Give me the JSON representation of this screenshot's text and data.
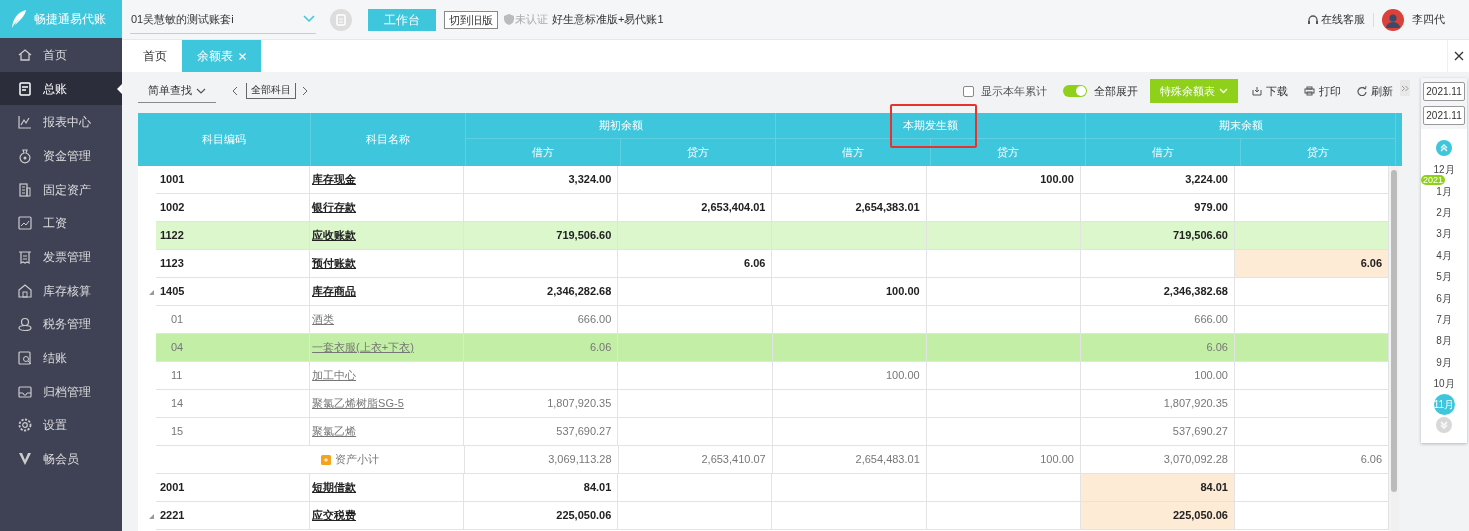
{
  "brand": {
    "name": "畅捷通易代账"
  },
  "topbar": {
    "account_set": "01吴慧敏的测试账套i",
    "workbench_button": "工作台",
    "old_version_button": "切到旧版",
    "certification": "未认证",
    "edition": "好生意标准版+易代账1",
    "support": "在线客服",
    "user": "李四代"
  },
  "sidebar": {
    "items": [
      {
        "label": "首页",
        "selected": false
      },
      {
        "label": "总账",
        "selected": true
      },
      {
        "label": "报表中心",
        "selected": false
      },
      {
        "label": "资金管理",
        "selected": false
      },
      {
        "label": "固定资产",
        "selected": false
      },
      {
        "label": "工资",
        "selected": false
      },
      {
        "label": "发票管理",
        "selected": false
      },
      {
        "label": "库存核算",
        "selected": false
      },
      {
        "label": "税务管理",
        "selected": false
      },
      {
        "label": "结账",
        "selected": false
      },
      {
        "label": "归档管理",
        "selected": false
      },
      {
        "label": "设置",
        "selected": false
      },
      {
        "label": "畅会员",
        "selected": false
      }
    ]
  },
  "tabs": [
    {
      "label": "首页",
      "selected": false,
      "closable": false
    },
    {
      "label": "余额表",
      "selected": true,
      "closable": true
    }
  ],
  "toolbar": {
    "search_mode": "简单查找",
    "subject_filter": "全部科目",
    "show_year_total": {
      "label": "显示本年累计",
      "checked": false
    },
    "expand_all": {
      "label": "全部展开",
      "on": true
    },
    "special_button": "特殊余额表",
    "download": "下载",
    "print": "打印",
    "refresh": "刷新"
  },
  "table": {
    "columns": [
      {
        "label": "科目编码"
      },
      {
        "label": "科目名称"
      }
    ],
    "groups": [
      {
        "label": "期初余额",
        "outlined": false,
        "sub": [
          "借方",
          "贷方"
        ]
      },
      {
        "label": "本期发生额",
        "outlined": true,
        "sub": [
          "借方",
          "贷方"
        ]
      },
      {
        "label": "期末余额",
        "outlined": false,
        "sub": [
          "借方",
          "贷方"
        ]
      }
    ],
    "rows": [
      {
        "kind": "account",
        "code": "1001",
        "name": "库存现金",
        "selected": false,
        "highlighted": false,
        "cells": [
          {
            "value": "3,324.00",
            "flagged": false
          },
          {
            "flagged": false
          },
          {
            "flagged": false
          },
          {
            "value": "100.00",
            "flagged": false
          },
          {
            "value": "3,224.00",
            "flagged": false
          },
          {
            "flagged": false
          }
        ]
      },
      {
        "kind": "account",
        "code": "1002",
        "name": "银行存款",
        "selected": false,
        "highlighted": false,
        "cells": [
          {
            "flagged": false
          },
          {
            "value": "2,653,404.01",
            "flagged": false
          },
          {
            "value": "2,654,383.01",
            "flagged": false
          },
          {
            "flagged": false
          },
          {
            "value": "979.00",
            "flagged": false
          },
          {
            "flagged": false
          }
        ]
      },
      {
        "kind": "account",
        "code": "1122",
        "name": "应收账款",
        "selected": false,
        "highlighted": true,
        "cells": [
          {
            "value": "719,506.60",
            "flagged": false
          },
          {
            "flagged": false
          },
          {
            "flagged": false
          },
          {
            "flagged": false
          },
          {
            "value": "719,506.60",
            "flagged": false
          },
          {
            "flagged": false
          }
        ]
      },
      {
        "kind": "account",
        "code": "1123",
        "name": "预付账款",
        "selected": false,
        "highlighted": false,
        "cells": [
          {
            "flagged": false
          },
          {
            "value": "6.06",
            "flagged": false
          },
          {
            "flagged": false
          },
          {
            "flagged": false
          },
          {
            "flagged": false
          },
          {
            "value": "6.06",
            "flagged": true
          }
        ]
      },
      {
        "kind": "account",
        "code": "1405",
        "name": "库存商品",
        "selected": false,
        "highlighted": false,
        "expanded": true,
        "cells": [
          {
            "value": "2,346,282.68",
            "flagged": false
          },
          {
            "flagged": false
          },
          {
            "value": "100.00",
            "flagged": false
          },
          {
            "flagged": false
          },
          {
            "value": "2,346,382.68",
            "flagged": false
          },
          {
            "flagged": false
          }
        ],
        "children": [
          {
            "kind": "sub",
            "code": "01",
            "name": "酒类",
            "selected": false,
            "highlighted": false,
            "cells": [
              {
                "value": "666.00",
                "flagged": false
              },
              {
                "flagged": false
              },
              {
                "flagged": false
              },
              {
                "flagged": false
              },
              {
                "value": "666.00",
                "flagged": false
              },
              {
                "flagged": false
              }
            ]
          },
          {
            "kind": "sub",
            "code": "04",
            "name": "一套衣服(上衣+下衣)",
            "selected": true,
            "highlighted": false,
            "cells": [
              {
                "value": "6.06",
                "flagged": false
              },
              {
                "flagged": false
              },
              {
                "flagged": false
              },
              {
                "flagged": false
              },
              {
                "value": "6.06",
                "flagged": false
              },
              {
                "flagged": false
              }
            ]
          },
          {
            "kind": "sub",
            "code": "11",
            "name": "加工中心",
            "selected": false,
            "highlighted": false,
            "cells": [
              {
                "flagged": false
              },
              {
                "flagged": false
              },
              {
                "value": "100.00",
                "flagged": false
              },
              {
                "flagged": false
              },
              {
                "value": "100.00",
                "flagged": false
              },
              {
                "flagged": false
              }
            ]
          },
          {
            "kind": "sub",
            "code": "14",
            "name": "聚氯乙烯树脂SG-5",
            "selected": false,
            "highlighted": false,
            "cells": [
              {
                "value": "1,807,920.35",
                "flagged": false
              },
              {
                "flagged": false
              },
              {
                "flagged": false
              },
              {
                "flagged": false
              },
              {
                "value": "1,807,920.35",
                "flagged": false
              },
              {
                "flagged": false
              }
            ]
          },
          {
            "kind": "sub",
            "code": "15",
            "name": "聚氯乙烯",
            "selected": false,
            "highlighted": false,
            "cells": [
              {
                "value": "537,690.27",
                "flagged": false
              },
              {
                "flagged": false
              },
              {
                "flagged": false
              },
              {
                "flagged": false
              },
              {
                "value": "537,690.27",
                "flagged": false
              },
              {
                "flagged": false
              }
            ]
          }
        ]
      },
      {
        "kind": "subtotal",
        "name": "资产小计",
        "selected": false,
        "highlighted": false,
        "cells": [
          {
            "value": "3,069,113.28",
            "flagged": false
          },
          {
            "value": "2,653,410.07",
            "flagged": false
          },
          {
            "value": "2,654,483.01",
            "flagged": false
          },
          {
            "value": "100.00",
            "flagged": false
          },
          {
            "value": "3,070,092.28",
            "flagged": false
          },
          {
            "value": "6.06",
            "flagged": false
          }
        ]
      },
      {
        "kind": "account",
        "code": "2001",
        "name": "短期借款",
        "selected": false,
        "highlighted": false,
        "cells": [
          {
            "value": "84.01",
            "flagged": false
          },
          {
            "flagged": false
          },
          {
            "flagged": false
          },
          {
            "flagged": false
          },
          {
            "value": "84.01",
            "flagged": true
          },
          {
            "flagged": false
          }
        ]
      },
      {
        "kind": "account",
        "code": "2221",
        "name": "应交税费",
        "selected": false,
        "highlighted": false,
        "expanded": true,
        "cells": [
          {
            "value": "225,050.06",
            "flagged": false
          },
          {
            "flagged": false
          },
          {
            "flagged": false
          },
          {
            "flagged": false
          },
          {
            "value": "225,050.06",
            "flagged": true
          },
          {
            "flagged": false
          }
        ]
      }
    ]
  },
  "period_panel": {
    "start": "2021.11",
    "end": "2021.11",
    "months": [
      {
        "label": "12月",
        "selected": false
      },
      {
        "label": "1月",
        "selected": false,
        "year": "2021"
      },
      {
        "label": "2月",
        "selected": false
      },
      {
        "label": "3月",
        "selected": false
      },
      {
        "label": "4月",
        "selected": false
      },
      {
        "label": "5月",
        "selected": false
      },
      {
        "label": "6月",
        "selected": false
      },
      {
        "label": "7月",
        "selected": false
      },
      {
        "label": "8月",
        "selected": false
      },
      {
        "label": "9月",
        "selected": false
      },
      {
        "label": "10月",
        "selected": false
      },
      {
        "label": "11月",
        "selected": true
      }
    ]
  }
}
